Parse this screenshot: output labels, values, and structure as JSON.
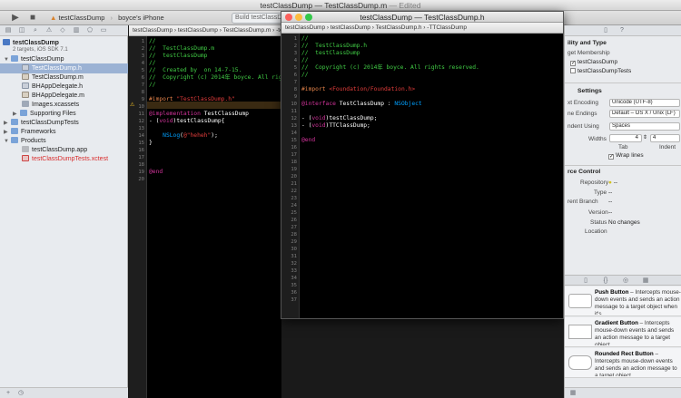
{
  "titlebar": {
    "file": "testClassDump",
    "sep": "—",
    "file2": "TestClassDump.m",
    "edited": "— Edited"
  },
  "toolbar": {
    "scheme": "testClassDump",
    "device": "boyce's iPhone",
    "activity": "Build testClassDump"
  },
  "navigator": {
    "project": "testClassDump",
    "project_sub": "2 targets, iOS SDK 7.1",
    "items": [
      {
        "label": "testClassDump"
      },
      {
        "label": "TestClassDump.h"
      },
      {
        "label": "TestClassDump.m"
      },
      {
        "label": "BHAppDelegate.h"
      },
      {
        "label": "BHAppDelegate.m"
      },
      {
        "label": "Images.xcassets"
      },
      {
        "label": "Supporting Files"
      },
      {
        "label": "testClassDumpTests"
      },
      {
        "label": "Frameworks"
      },
      {
        "label": "Products"
      },
      {
        "label": "testClassDump.app"
      },
      {
        "label": "testClassDumpTests.xctest"
      }
    ]
  },
  "editor_left": {
    "jumpbar": "testClassDump  ›  testClassDump  ›  TestClassDump.m  ›  -testClassDump",
    "lines": [
      {
        "n": "1",
        "t": "//"
      },
      {
        "n": "2",
        "t": "//  TestClassDump.m"
      },
      {
        "n": "3",
        "t": "//  testClassDump"
      },
      {
        "n": "4",
        "t": "//"
      },
      {
        "n": "5",
        "t": "//  Created by  on 14-7-15."
      },
      {
        "n": "6",
        "t": "//  Copyright (c) 2014年 boyce. All righ"
      },
      {
        "n": "7",
        "t": "//"
      },
      {
        "n": "8",
        "t": ""
      },
      {
        "n": "9",
        "t": "#import \"TestClassDump.h\""
      },
      {
        "n": "10",
        "t": ""
      },
      {
        "n": "11",
        "t": "@implementation TestClassDump"
      },
      {
        "n": "12",
        "t": "- (void)testClassDump{"
      },
      {
        "n": "13",
        "t": ""
      },
      {
        "n": "14",
        "t": "    NSLog(@\"heheh\");"
      },
      {
        "n": "15",
        "t": "}"
      },
      {
        "n": "16",
        "t": ""
      },
      {
        "n": "17",
        "t": ""
      },
      {
        "n": "18",
        "t": ""
      },
      {
        "n": "19",
        "t": "@end"
      },
      {
        "n": "20",
        "t": ""
      }
    ]
  },
  "window": {
    "title": "testClassDump  —  TestClassDump.h",
    "jumpbar": "testClassDump  ›  testClassDump  ›  TestClassDump.h  ›  -TTClassDump",
    "lines": [
      {
        "n": "1",
        "t": "//"
      },
      {
        "n": "2",
        "t": "//  TestClassDump.h"
      },
      {
        "n": "3",
        "t": "//  testClassDump"
      },
      {
        "n": "4",
        "t": "//"
      },
      {
        "n": "5",
        "t": "//  Copyright (c) 2014年 boyce. All rights reserved."
      },
      {
        "n": "6",
        "t": "//"
      },
      {
        "n": "7",
        "t": ""
      },
      {
        "n": "8",
        "t": "#import <Foundation/Foundation.h>"
      },
      {
        "n": "9",
        "t": ""
      },
      {
        "n": "10",
        "t": "@interface TestClassDump : NSObject"
      },
      {
        "n": "11",
        "t": ""
      },
      {
        "n": "12",
        "t": "- (void)testClassDump;"
      },
      {
        "n": "13",
        "t": "- (void)TTClassDump;"
      },
      {
        "n": "14",
        "t": ""
      },
      {
        "n": "15",
        "t": "@end"
      },
      {
        "n": "16",
        "t": ""
      },
      {
        "n": "17",
        "t": ""
      },
      {
        "n": "18",
        "t": ""
      },
      {
        "n": "19",
        "t": ""
      },
      {
        "n": "20",
        "t": ""
      },
      {
        "n": "21",
        "t": ""
      },
      {
        "n": "22",
        "t": ""
      },
      {
        "n": "23",
        "t": ""
      },
      {
        "n": "24",
        "t": ""
      },
      {
        "n": "25",
        "t": ""
      },
      {
        "n": "26",
        "t": ""
      },
      {
        "n": "27",
        "t": ""
      },
      {
        "n": "28",
        "t": ""
      },
      {
        "n": "29",
        "t": ""
      },
      {
        "n": "30",
        "t": ""
      },
      {
        "n": "31",
        "t": ""
      },
      {
        "n": "32",
        "t": ""
      },
      {
        "n": "33",
        "t": ""
      },
      {
        "n": "34",
        "t": ""
      },
      {
        "n": "35",
        "t": ""
      },
      {
        "n": "36",
        "t": ""
      },
      {
        "n": "37",
        "t": ""
      }
    ]
  },
  "utilities": {
    "section1": "ility and Type",
    "target_membership": "get Membership",
    "target1": "testClassDump",
    "target2": "testClassDumpTests",
    "settings": "Settings",
    "text_encoding_label": "xt Encoding",
    "text_encoding": "Unicode (UTF-8)",
    "line_endings_label": "ne Endings",
    "line_endings": "Default – OS X / Unix (LF)",
    "indent_label": "ndent Using",
    "indent_value": "Spaces",
    "widths_label": "Widths",
    "tab_width": "4",
    "indent_width": "4",
    "tab_caption": "Tab",
    "indent_caption": "Indent",
    "wrap_lines": "Wrap lines",
    "source_control": "rce Control",
    "repository_label": "Repository",
    "repository": "--",
    "type_label": "Type",
    "type": "--",
    "branch_label": "rent Branch",
    "branch": "--",
    "version_label": "Version",
    "version": "--",
    "status_label": "Status",
    "status": "No changes",
    "location_label": "Location",
    "library": [
      {
        "title": "Push Button",
        "desc": " – Intercepts mouse-down events and sends an action message to a target object when it's"
      },
      {
        "title": "Gradient Button",
        "desc": " – Intercepts mouse-down events and sends an action message to a target object."
      },
      {
        "title": "Rounded Rect Button",
        "desc": " – Intercepts mouse-down events and sends an action message to a target object."
      }
    ]
  }
}
